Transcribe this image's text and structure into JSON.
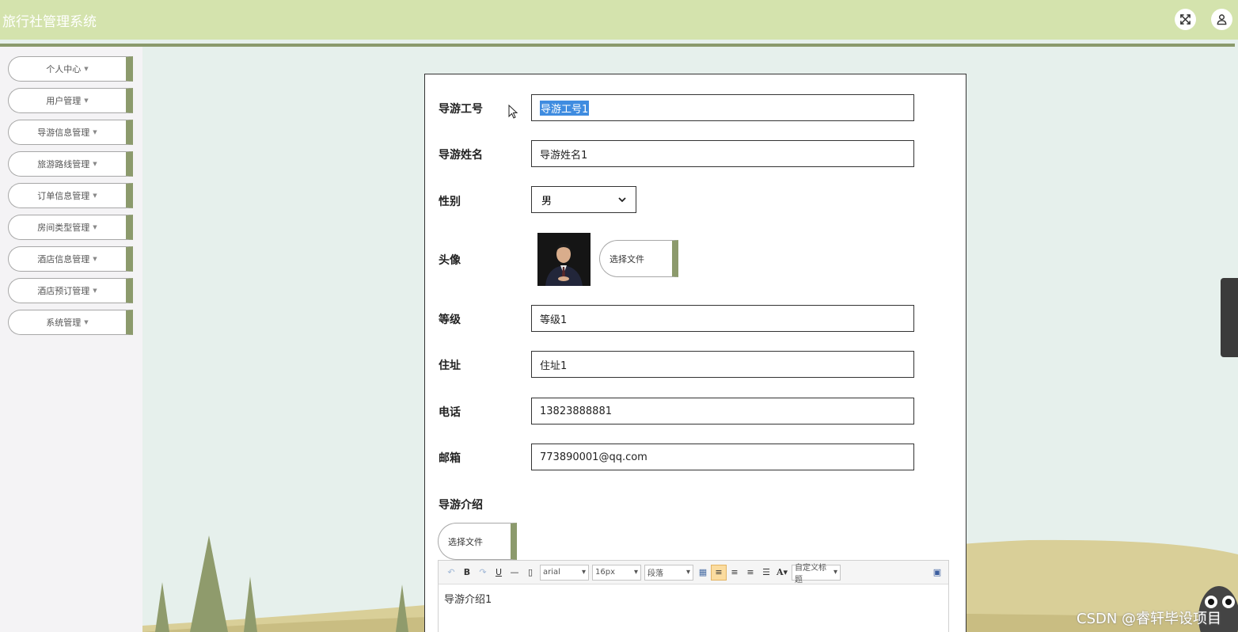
{
  "app": {
    "title": "旅行社管理系统"
  },
  "header": {
    "fullscreen_icon": "fullscreen-icon",
    "user_icon": "user-icon"
  },
  "sidebar": {
    "items": [
      {
        "label": "个人中心"
      },
      {
        "label": "用户管理"
      },
      {
        "label": "导游信息管理"
      },
      {
        "label": "旅游路线管理"
      },
      {
        "label": "订单信息管理"
      },
      {
        "label": "房间类型管理"
      },
      {
        "label": "酒店信息管理"
      },
      {
        "label": "酒店预订管理"
      },
      {
        "label": "系统管理"
      }
    ]
  },
  "form": {
    "guide_id": {
      "label": "导游工号",
      "value": "导游工号1"
    },
    "guide_name": {
      "label": "导游姓名",
      "value": "导游姓名1"
    },
    "gender": {
      "label": "性别",
      "value": "男"
    },
    "avatar": {
      "label": "头像",
      "upload_label": "选择文件"
    },
    "level": {
      "label": "等级",
      "value": "等级1"
    },
    "address": {
      "label": "住址",
      "value": "住址1"
    },
    "phone": {
      "label": "电话",
      "value": "13823888881"
    },
    "email": {
      "label": "邮箱",
      "value": "773890001@qq.com"
    },
    "intro": {
      "label": "导游介绍",
      "upload_label": "选择文件",
      "content": "导游介绍1",
      "toolbar": {
        "font_family": "arial",
        "font_size": "16px",
        "paragraph": "段落",
        "custom_title": "自定义标题"
      }
    }
  },
  "watermark": "CSDN @睿轩毕设项目"
}
